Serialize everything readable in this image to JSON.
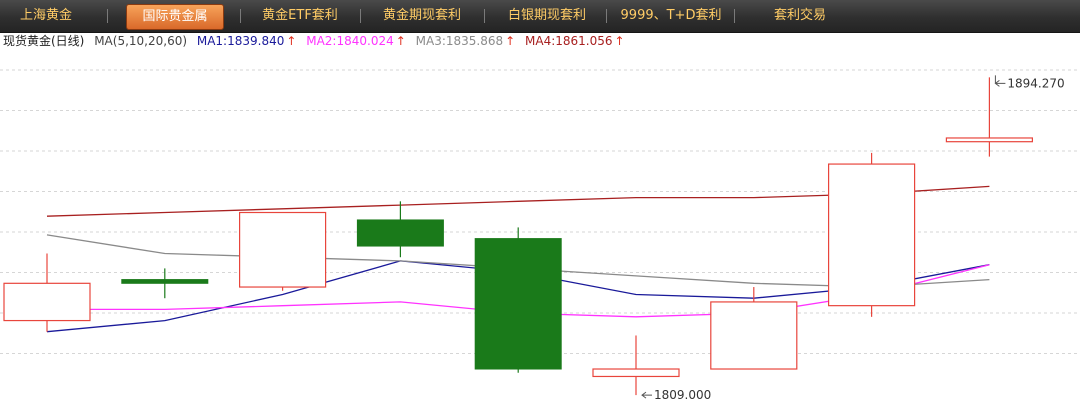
{
  "tabs": [
    {
      "label": "上海黄金",
      "active": false
    },
    {
      "label": "国际贵金属",
      "active": true
    },
    {
      "label": "黄金ETF套利",
      "active": false
    },
    {
      "label": "黄金期现套利",
      "active": false
    },
    {
      "label": "白银期现套利",
      "active": false
    },
    {
      "label": "9999、T+D套利",
      "active": false
    },
    {
      "label": "套利交易",
      "active": false
    }
  ],
  "legend": {
    "title": "现货黄金(日线)",
    "params": "MA(5,10,20,60)",
    "ma1": "MA1:1839.840",
    "ma2": "MA2:1840.024",
    "ma3": "MA3:1835.868",
    "ma4": "MA4:1861.056",
    "up_arrow": "↑"
  },
  "colors": {
    "up": "#e8453c",
    "down": "#1a7a1a",
    "ma1": "#1a1a9a",
    "ma2": "#ff33ff",
    "ma3": "#8a8a8a",
    "ma4": "#a82020",
    "grid": "#d6d6d6",
    "arrow_up": "#e03020"
  },
  "chart_data": {
    "type": "candlestick",
    "ylim": [
      1805,
      1900
    ],
    "grid": "horizontal dashed",
    "candles": [
      {
        "open": 1829,
        "close": 1839,
        "high": 1847,
        "low": 1826
      },
      {
        "open": 1840,
        "close": 1839,
        "high": 1843,
        "low": 1835
      },
      {
        "open": 1838,
        "close": 1858,
        "high": 1858,
        "low": 1837
      },
      {
        "open": 1856,
        "close": 1849,
        "high": 1861,
        "low": 1846
      },
      {
        "open": 1851,
        "close": 1816,
        "high": 1854,
        "low": 1815
      },
      {
        "open": 1814,
        "close": 1816,
        "high": 1825,
        "low": 1809
      },
      {
        "open": 1816,
        "close": 1834,
        "high": 1838,
        "low": 1816
      },
      {
        "open": 1833,
        "close": 1871,
        "high": 1874,
        "low": 1830
      },
      {
        "open": 1877,
        "close": 1878,
        "high": 1894.27,
        "low": 1873
      }
    ],
    "annotations": [
      {
        "label": "1894.270",
        "candle": 8,
        "value": 1894.27,
        "kind": "high"
      },
      {
        "label": "1809.000",
        "candle": 5,
        "value": 1809,
        "kind": "low"
      }
    ],
    "series": [
      {
        "name": "MA1",
        "values": [
          1826,
          1829,
          1836,
          1845,
          1842,
          1836,
          1835,
          1838,
          1844
        ]
      },
      {
        "name": "MA2",
        "values": [
          1832,
          1832,
          1833,
          1834,
          1831,
          1830,
          1831,
          1836,
          1844
        ]
      },
      {
        "name": "MA3",
        "values": [
          1852,
          1847,
          1846,
          1845,
          1843,
          1841,
          1839,
          1838,
          1840
        ]
      },
      {
        "name": "MA4",
        "values": [
          1857,
          1858,
          1859,
          1860,
          1861,
          1862,
          1862,
          1863,
          1865
        ]
      }
    ]
  }
}
